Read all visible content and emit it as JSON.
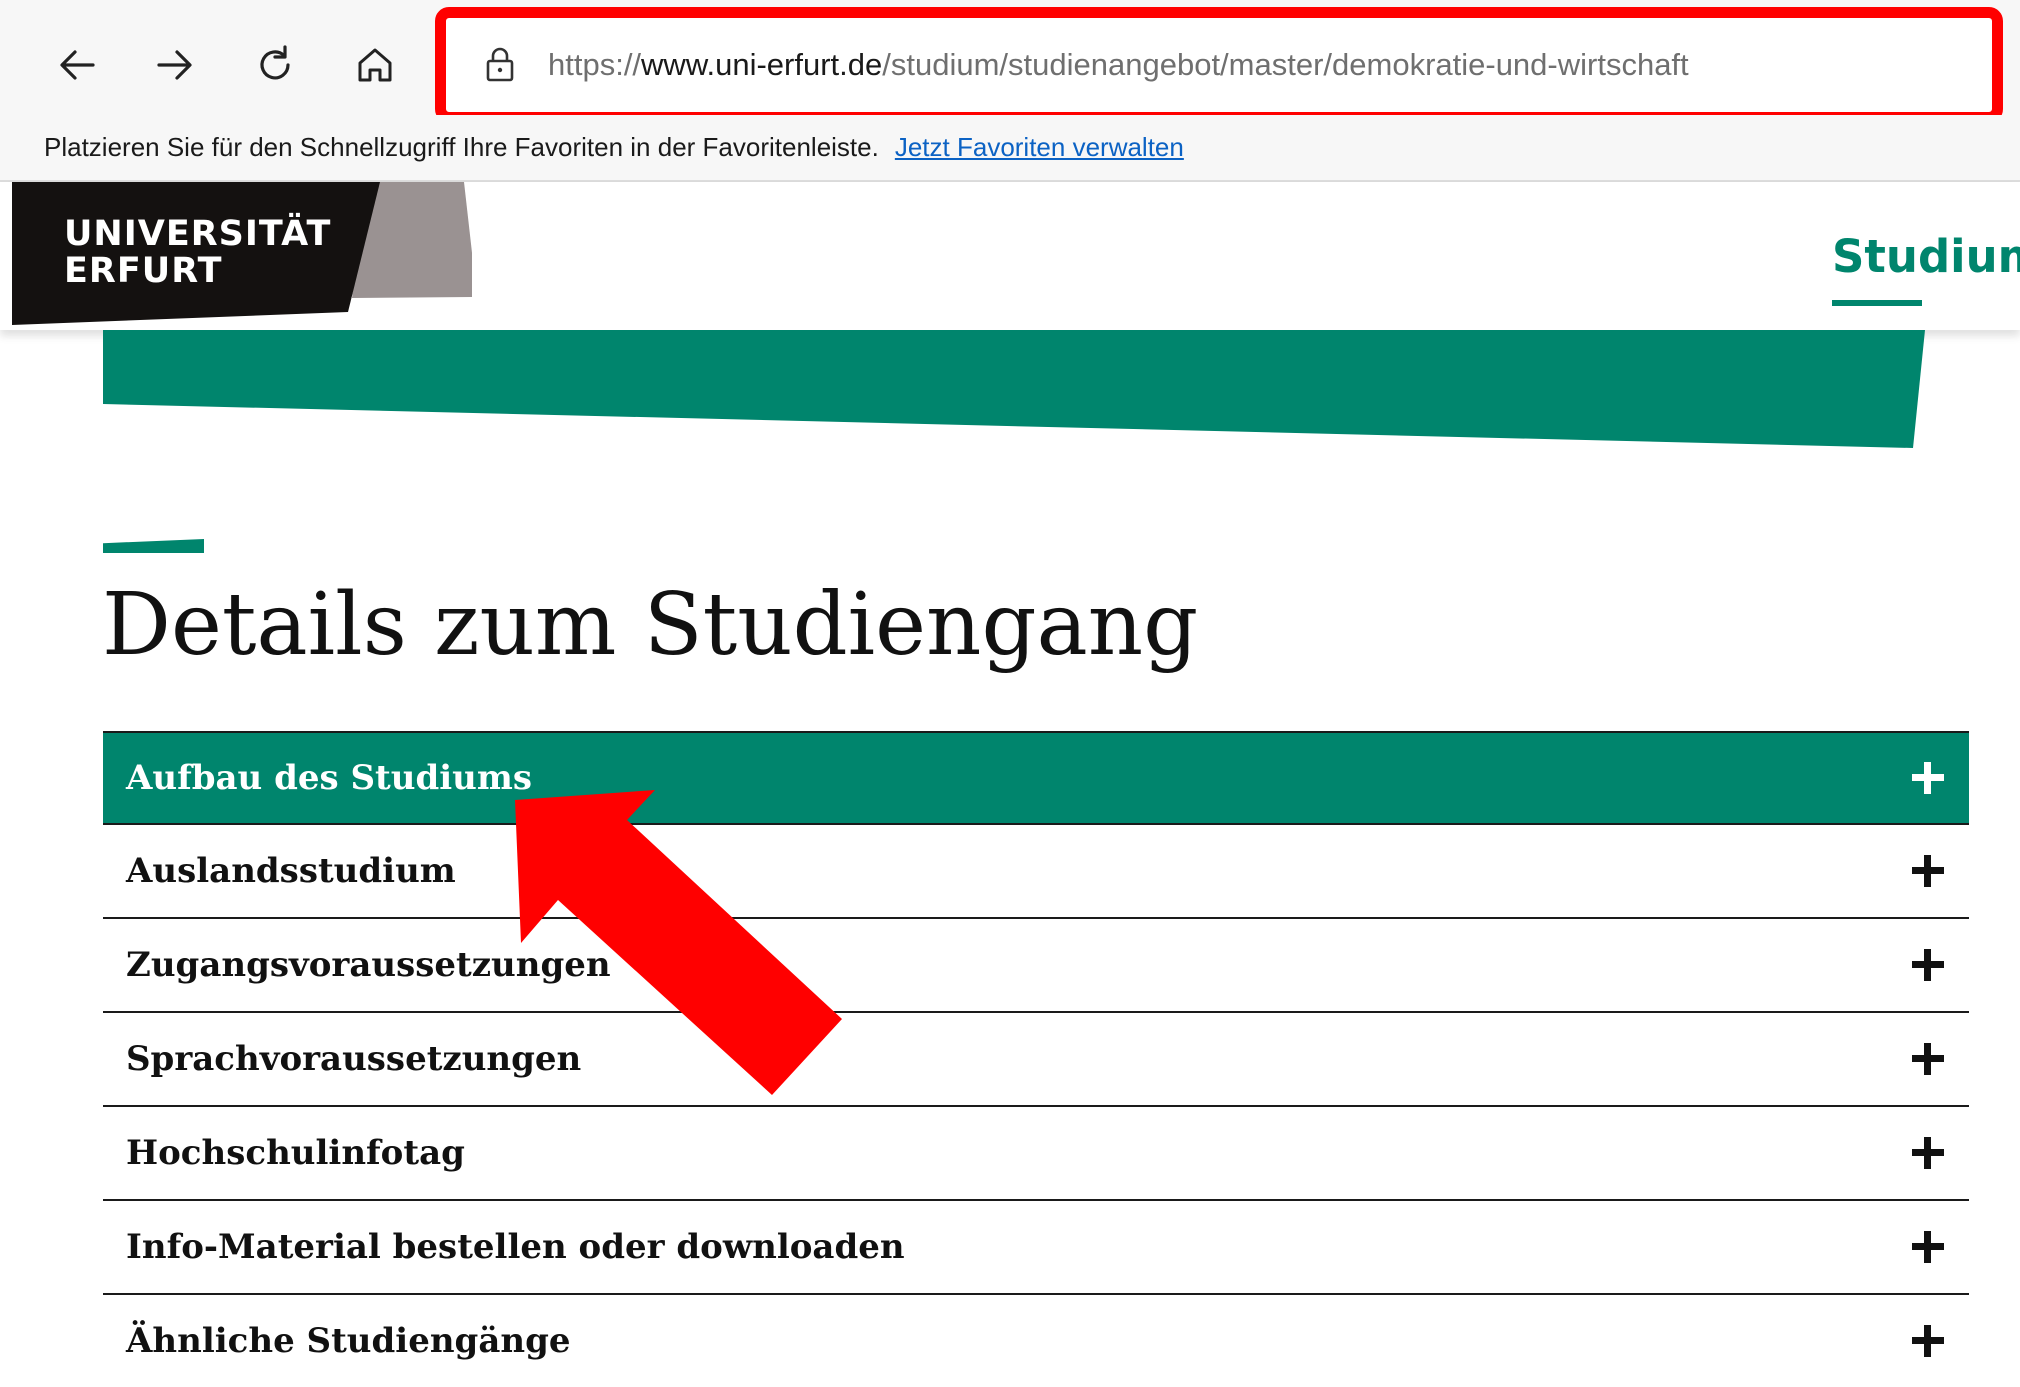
{
  "browser": {
    "url": {
      "scheme": "https://",
      "host": "www.uni-erfurt.de",
      "path": "/studium/studienangebot/master/demokratie-und-wirtschaft"
    },
    "favorites_bar": {
      "message": "Platzieren Sie für den Schnellzugriff Ihre Favoriten in der Favoritenleiste.",
      "link": "Jetzt Favoriten verwalten"
    },
    "highlight_color": "#ff0000"
  },
  "site": {
    "logo": {
      "line1": "UNIVERSITÄT",
      "line2": "ERFURT"
    },
    "nav": {
      "active": "Studium"
    },
    "accent_color": "#00856d"
  },
  "content": {
    "section_title": "Details zum Studiengang",
    "accordion": [
      {
        "label": "Aufbau des Studiums",
        "active": true
      },
      {
        "label": "Auslandsstudium",
        "active": false
      },
      {
        "label": "Zugangsvoraussetzungen",
        "active": false
      },
      {
        "label": "Sprachvoraussetzungen",
        "active": false
      },
      {
        "label": "Hochschulinfotag",
        "active": false
      },
      {
        "label": "Info-Material bestellen oder downloaden",
        "active": false
      },
      {
        "label": "Ähnliche Studiengänge",
        "active": false
      }
    ]
  },
  "annotation": {
    "arrow_color": "#ff0000",
    "points_to": "Aufbau des Studiums"
  }
}
